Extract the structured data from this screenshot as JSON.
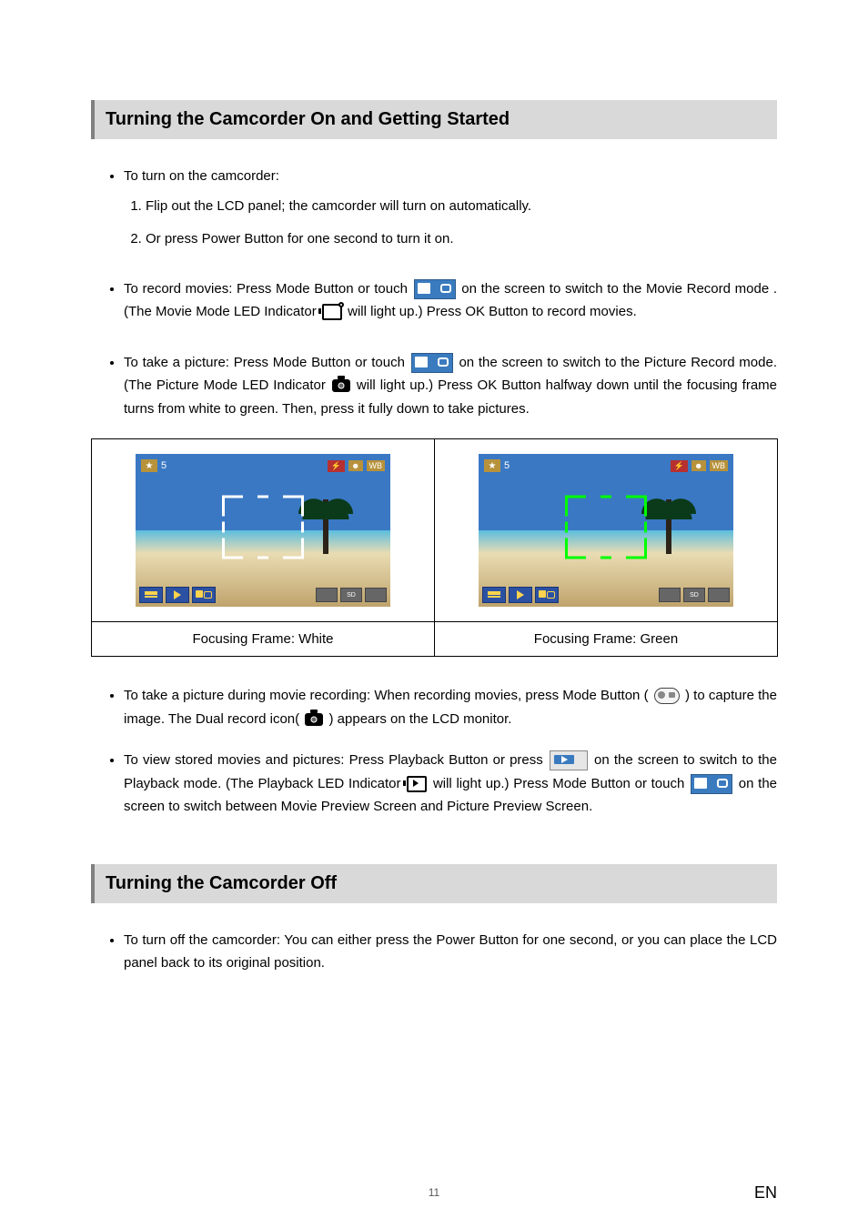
{
  "sectionA": {
    "title": "Turning the Camcorder On and Getting Started",
    "intro": "To turn on the camcorder:",
    "steps": {
      "s1": "Flip out the LCD panel; the camcorder will turn on automatically.",
      "s2": "Or press Power Button for one second to turn it on."
    },
    "recordMovies": {
      "before": "To record movies: Press Mode Button or touch ",
      "mid1": " on the screen to switch to the Movie Record mode .(The Movie Mode LED Indicator ",
      "after": " will light up.) Press OK Button to record movies."
    },
    "takePicture": {
      "before": "To take a picture: Press Mode Button or touch ",
      "mid1": " on the screen to switch to the Picture Record mode. (The Picture Mode LED Indicator ",
      "after": " will light up.) Press OK Button halfway down until the focusing frame turns from white to green. Then, press it fully down to take pictures."
    },
    "frameTable": {
      "overlayCount": "5",
      "overlayWB": "WB",
      "whiteCaption": "Focusing Frame: White",
      "greenCaption": "Focusing Frame: Green"
    },
    "dualRecord": {
      "before": "To take a picture during movie recording: When recording movies, press Mode Button (",
      "mid": ") to capture the image. The Dual record icon( ",
      "after": " ) appears on the LCD monitor."
    },
    "viewStored": {
      "before": "To view stored movies and pictures: Press Playback Button or press ",
      "mid1": " on the screen to switch to the Playback mode. (The Playback LED Indicator ",
      "mid2": " will light up.) Press Mode Button or touch ",
      "after": " on the screen to switch between Movie Preview Screen and Picture Preview Screen."
    }
  },
  "sectionB": {
    "title": "Turning the Camcorder Off",
    "text": "To turn off the camcorder: You can either press the Power Button for one second, or you can place the LCD panel back to its original position."
  },
  "footer": {
    "page": "11",
    "lang": "EN"
  }
}
